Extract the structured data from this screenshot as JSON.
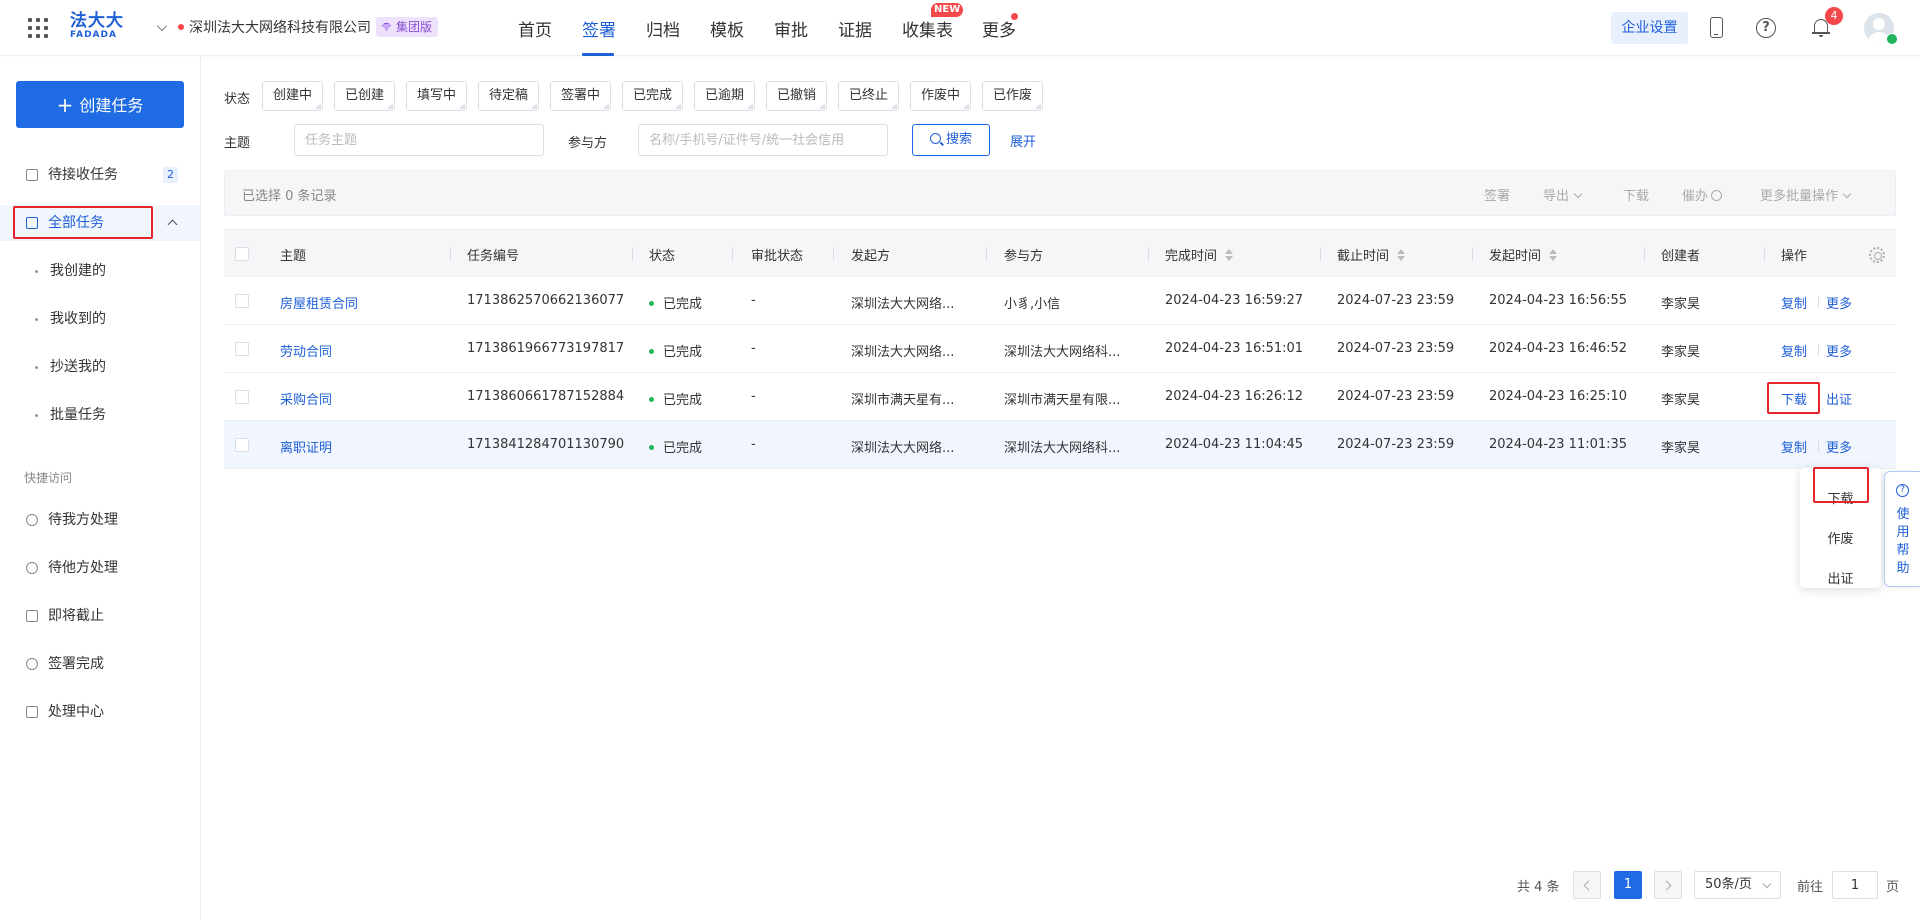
{
  "header": {
    "logo_top": "法大大",
    "logo_bottom": "FADADA",
    "company": "深圳法大大网络科技有限公司",
    "edition": "集团版",
    "nav": [
      {
        "label": "首页"
      },
      {
        "label": "签署"
      },
      {
        "label": "归档"
      },
      {
        "label": "模板"
      },
      {
        "label": "审批"
      },
      {
        "label": "证据"
      },
      {
        "label": "收集表"
      },
      {
        "label": "更多"
      }
    ],
    "new_badge": "NEW",
    "enterprise_settings": "企业设置",
    "notification_count": "4",
    "colors": {
      "accent": "#1e5fd8",
      "danger": "#f5484b"
    }
  },
  "sidebar": {
    "create_label": "创建任务",
    "pending_receive": {
      "label": "待接收任务",
      "count": "2"
    },
    "all_tasks": "全部任务",
    "sub_items": [
      "我创建的",
      "我收到的",
      "抄送我的",
      "批量任务"
    ],
    "quick_access_title": "快捷访问",
    "quick_items": [
      "待我方处理",
      "待他方处理",
      "即将截止",
      "签署完成",
      "处理中心"
    ]
  },
  "filters": {
    "status_label": "状态",
    "statuses": [
      "创建中",
      "已创建",
      "填写中",
      "待定稿",
      "签署中",
      "已完成",
      "已逾期",
      "已撤销",
      "已终止",
      "作废中",
      "已作废"
    ],
    "subject_label": "主题",
    "subject_placeholder": "任务主题",
    "participant_label": "参与方",
    "participant_placeholder": "名称/手机号/证件号/统一社会信用",
    "search_label": "搜索",
    "expand_label": "展开"
  },
  "batch": {
    "selected_text": "已选择 0 条记录",
    "sign": "签署",
    "export": "导出",
    "download": "下载",
    "remind": "催办",
    "more_batch": "更多批量操作"
  },
  "table": {
    "columns": [
      "主题",
      "任务编号",
      "状态",
      "审批状态",
      "发起方",
      "参与方",
      "完成时间",
      "截止时间",
      "发起时间",
      "创建者",
      "操作"
    ],
    "rows": [
      {
        "subject": "房屋租赁合同",
        "id": "1713862570662136077",
        "status": "已完成",
        "approval": "-",
        "initiator": "深圳法大大网络...",
        "participant": "小豸,小信",
        "completed": "2024-04-23 16:59:27",
        "deadline": "2024-07-23 23:59",
        "started": "2024-04-23 16:56:55",
        "creator": "李家昊",
        "op1": "复制",
        "op2": "更多"
      },
      {
        "subject": "劳动合同",
        "id": "1713861966773197817",
        "status": "已完成",
        "approval": "-",
        "initiator": "深圳法大大网络...",
        "participant": "深圳法大大网络科...",
        "completed": "2024-04-23 16:51:01",
        "deadline": "2024-07-23 23:59",
        "started": "2024-04-23 16:46:52",
        "creator": "李家昊",
        "op1": "复制",
        "op2": "更多"
      },
      {
        "subject": "采购合同",
        "id": "1713860661787152884",
        "status": "已完成",
        "approval": "-",
        "initiator": "深圳市满天星有...",
        "participant": "深圳市满天星有限...",
        "completed": "2024-04-23 16:26:12",
        "deadline": "2024-07-23 23:59",
        "started": "2024-04-23 16:25:10",
        "creator": "李家昊",
        "op1": "下载",
        "op2": "出证"
      },
      {
        "subject": "离职证明",
        "id": "1713841284701130790",
        "status": "已完成",
        "approval": "-",
        "initiator": "深圳法大大网络...",
        "participant": "深圳法大大网络科...",
        "completed": "2024-04-23 11:04:45",
        "deadline": "2024-07-23 23:59",
        "started": "2024-04-23 11:01:35",
        "creator": "李家昊",
        "op1": "复制",
        "op2": "更多"
      }
    ]
  },
  "dropdown": [
    "下载",
    "作废",
    "出证"
  ],
  "help_tab": "使用帮助",
  "pagination": {
    "total": "共 4 条",
    "current": "1",
    "page_size": "50条/页",
    "goto_label": "前往",
    "goto_value": "1",
    "page_suffix": "页"
  }
}
